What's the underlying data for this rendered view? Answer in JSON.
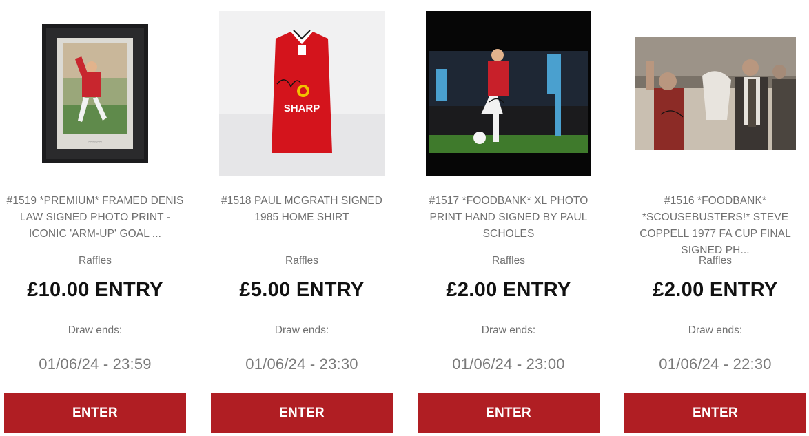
{
  "colors": {
    "accent": "#b01e23",
    "shirt_red": "#d4141c"
  },
  "products": [
    {
      "title": "#1519 *PREMIUM* FRAMED DENIS LAW SIGNED PHOTO PRINT - ICONIC 'ARM-UP' GOAL ...",
      "category": "Raffles",
      "price": "£10.00 ENTRY",
      "draw_label": "Draw ends:",
      "draw_date": "01/06/24 - 23:59",
      "button_label": "ENTER"
    },
    {
      "title": "#1518 PAUL MCGRATH SIGNED 1985 HOME SHIRT",
      "category": "Raffles",
      "price": "£5.00 ENTRY",
      "draw_label": "Draw ends:",
      "draw_date": "01/06/24 - 23:30",
      "button_label": "ENTER",
      "image_text": "SHARP"
    },
    {
      "title": "#1517 *FOODBANK* XL PHOTO PRINT HAND SIGNED BY PAUL SCHOLES",
      "category": "Raffles",
      "price": "£2.00 ENTRY",
      "draw_label": "Draw ends:",
      "draw_date": "01/06/24 - 23:00",
      "button_label": "ENTER"
    },
    {
      "title": "#1516 *FOODBANK* *SCOUSEBUSTERS!* STEVE COPPELL 1977 FA CUP FINAL SIGNED PH...",
      "category": "Raffles",
      "price": "£2.00 ENTRY",
      "draw_label": "Draw ends:",
      "draw_date": "01/06/24 - 22:30",
      "button_label": "ENTER"
    }
  ]
}
